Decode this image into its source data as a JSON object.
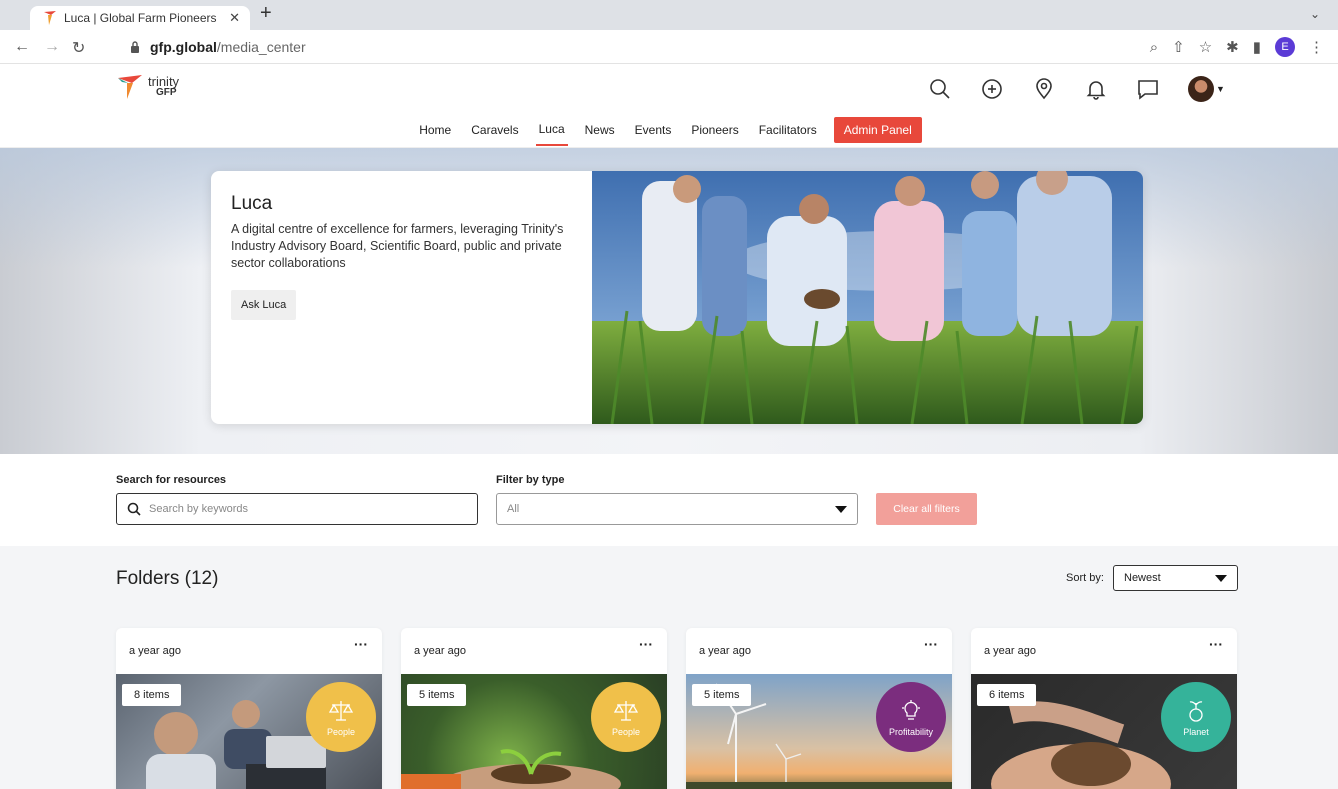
{
  "browser": {
    "tab_title": "Luca | Global Farm Pioneers",
    "url_host": "gfp.global",
    "url_path": "/media_center",
    "profile_initial": "E"
  },
  "header": {
    "brand": "trinity",
    "brand_sub": "GFP",
    "icons": [
      "search-icon",
      "plus-circle-icon",
      "location-pin-icon",
      "bell-icon",
      "chat-icon",
      "avatar"
    ]
  },
  "nav": {
    "items": [
      "Home",
      "Caravels",
      "Luca",
      "News",
      "Events",
      "Pioneers",
      "Facilitators"
    ],
    "active": "Luca",
    "admin_label": "Admin Panel",
    "accent": "#e8483b"
  },
  "hero": {
    "title": "Luca",
    "description": "A digital centre of excellence for farmers, leveraging Trinity's Industry Advisory Board, Scientific Board, public and private sector collaborations",
    "button": "Ask Luca"
  },
  "filters": {
    "search_label": "Search for resources",
    "search_placeholder": "Search by keywords",
    "type_label": "Filter by type",
    "type_value": "All",
    "clear_label": "Clear all filters"
  },
  "folders": {
    "title": "Folders (12)",
    "sort_label": "Sort by:",
    "sort_value": "Newest",
    "cards": [
      {
        "date": "a year ago",
        "count": "8 items",
        "category": "People",
        "color": "#f0c04a"
      },
      {
        "date": "a year ago",
        "count": "5 items",
        "category": "People",
        "color": "#f0c04a"
      },
      {
        "date": "a year ago",
        "count": "5 items",
        "category": "Profitability",
        "color": "#7b2d7e"
      },
      {
        "date": "a year ago",
        "count": "6 items",
        "category": "Planet",
        "color": "#35b39a"
      }
    ]
  }
}
